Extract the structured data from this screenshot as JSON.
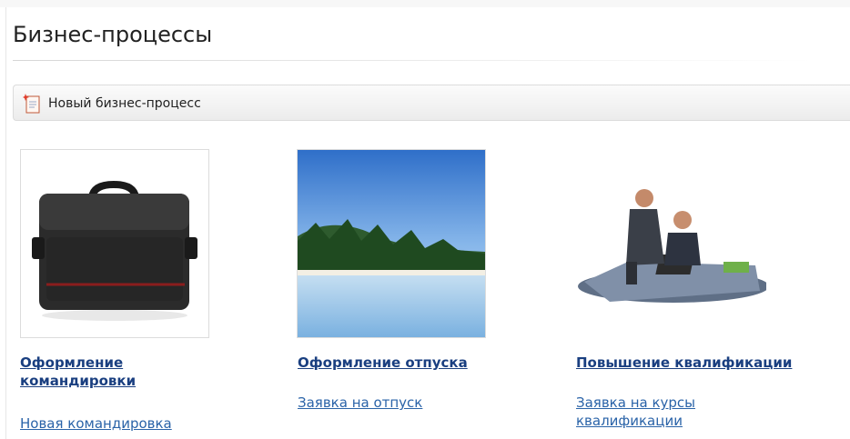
{
  "header": {
    "title": "Бизнес-процессы"
  },
  "toolbar": {
    "new_process_label": "Новый бизнес-процесс",
    "icon": "new-document-icon"
  },
  "processes": [
    {
      "title": "Оформление командировки",
      "link": "Новая командировка",
      "image": "bag-image"
    },
    {
      "title": "Оформление отпуска",
      "link": "Заявка на отпуск",
      "image": "beach-image"
    },
    {
      "title": "Повышение квалификации",
      "link": "Заявка на курсы квалификации",
      "image": "office-people-image"
    }
  ],
  "colors": {
    "title_link": "#1a3f80",
    "link": "#2a63a8",
    "toolbar_border": "#dcdcdc"
  }
}
